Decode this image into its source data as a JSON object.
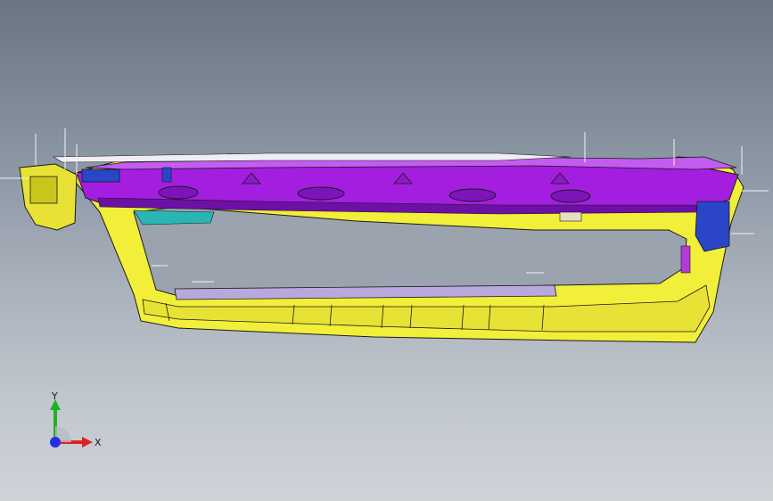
{
  "viewport": {
    "background_top": "#6a7482",
    "background_bottom": "#ced3d8"
  },
  "model": {
    "colors": {
      "trim_purple": "#a41ee0",
      "trim_purple_dark": "#6d10a6",
      "panel_lavender": "#b9a8dc",
      "blue_parts": "#2a45c8",
      "cyan_parts": "#2ab5b5",
      "frame_yellow": "#f2ef3a",
      "frame_yellow_shade": "#c9c51c",
      "edge_black": "#1a1a1a",
      "bracket_magenta": "#b43bd8"
    }
  },
  "triad": {
    "x_label": "X",
    "y_label": "Y",
    "x_color": "#e02020",
    "y_color": "#20b020",
    "z_color": "#2030e0"
  }
}
